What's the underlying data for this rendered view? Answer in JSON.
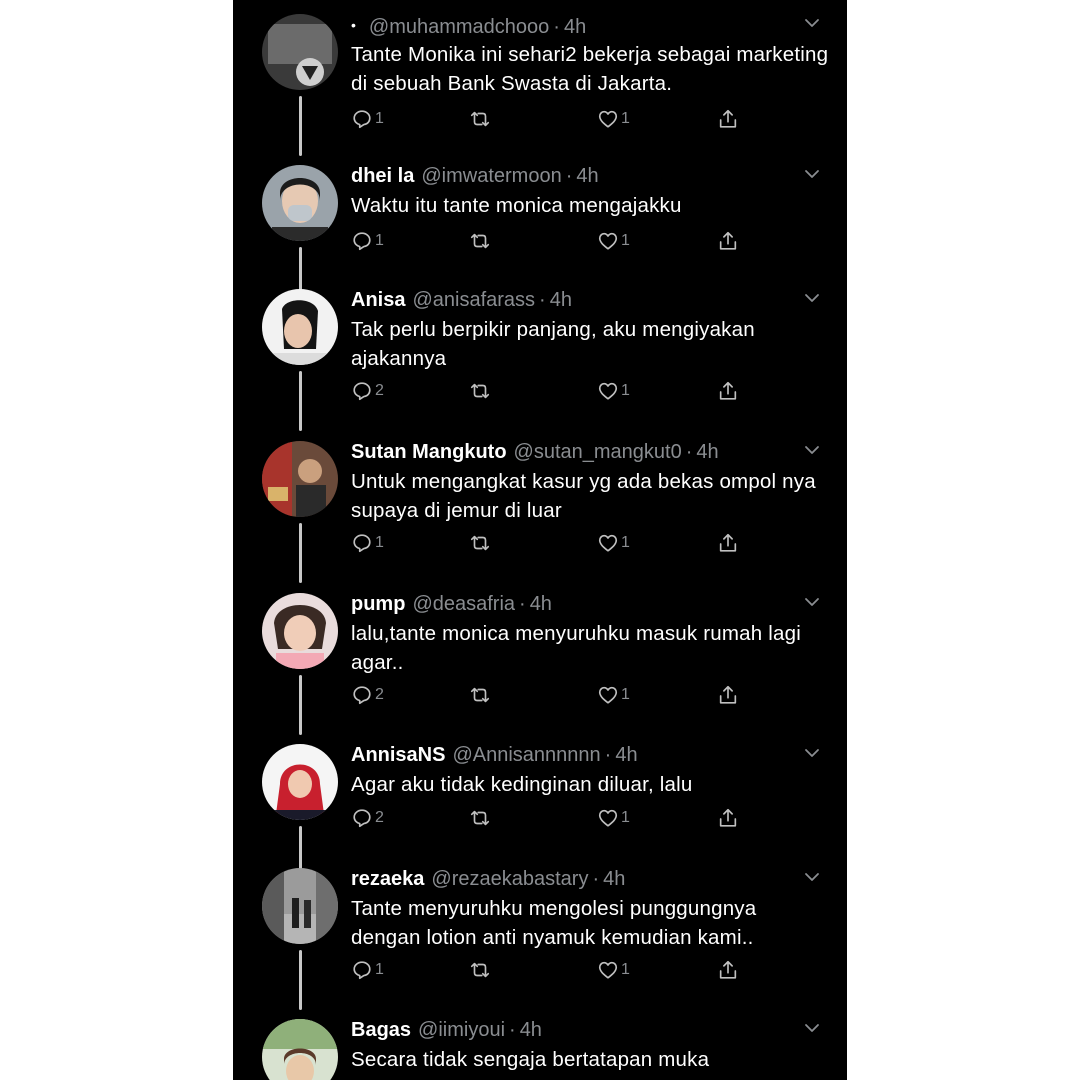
{
  "tweets": [
    {
      "display_name": "",
      "handle": "@muhammadchooo",
      "time": "4h",
      "bullet": "•",
      "text": "Tante Monika ini sehari2 bekerja sebagai marketing di sebuah Bank Swasta di Jakarta.",
      "replies": "1",
      "retweets": "",
      "likes": "1"
    },
    {
      "display_name": "dhei la",
      "handle": "@imwatermoon",
      "time": "4h",
      "bullet": "",
      "text": "Waktu itu tante monica mengajakku",
      "replies": "1",
      "retweets": "",
      "likes": "1"
    },
    {
      "display_name": "Anisa",
      "handle": "@anisafarass",
      "time": "4h",
      "bullet": "",
      "text": "Tak perlu berpikir panjang, aku mengiyakan ajakannya",
      "replies": "2",
      "retweets": "",
      "likes": "1"
    },
    {
      "display_name": "Sutan Mangkuto",
      "handle": "@sutan_mangkut0",
      "time": "4h",
      "bullet": "",
      "text": "Untuk mengangkat kasur yg ada bekas ompol nya supaya di jemur di luar",
      "replies": "1",
      "retweets": "",
      "likes": "1"
    },
    {
      "display_name": "pump",
      "handle": "@deasafria",
      "time": "4h",
      "bullet": "",
      "text": "lalu,tante monica menyuruhku masuk rumah lagi agar..",
      "replies": "2",
      "retweets": "",
      "likes": "1"
    },
    {
      "display_name": "AnnisaNS",
      "handle": "@Annisannnnnn",
      "time": "4h",
      "bullet": "",
      "text": "Agar aku tidak kedinginan diluar, lalu",
      "replies": "2",
      "retweets": "",
      "likes": "1"
    },
    {
      "display_name": "rezaeka",
      "handle": "@rezaekabastary",
      "time": "4h",
      "bullet": "",
      "text": "Tante menyuruhku mengolesi punggungnya dengan lotion anti nyamuk kemudian kami..",
      "replies": "1",
      "retweets": "",
      "likes": "1"
    },
    {
      "display_name": "Bagas",
      "handle": "@iimiyoui",
      "time": "4h",
      "bullet": "",
      "text": "Secara tidak sengaja bertatapan muka",
      "replies": "",
      "retweets": "",
      "likes": ""
    }
  ],
  "icons": {
    "reply": "reply-icon",
    "retweet": "retweet-icon",
    "like": "like-icon",
    "share": "share-icon",
    "more": "chevron-down-icon",
    "avatar": "avatar"
  },
  "colors": {
    "background": "#000000",
    "text": "#ffffff",
    "secondary": "#8a8d91",
    "thread_line": "#c8c8c8"
  }
}
